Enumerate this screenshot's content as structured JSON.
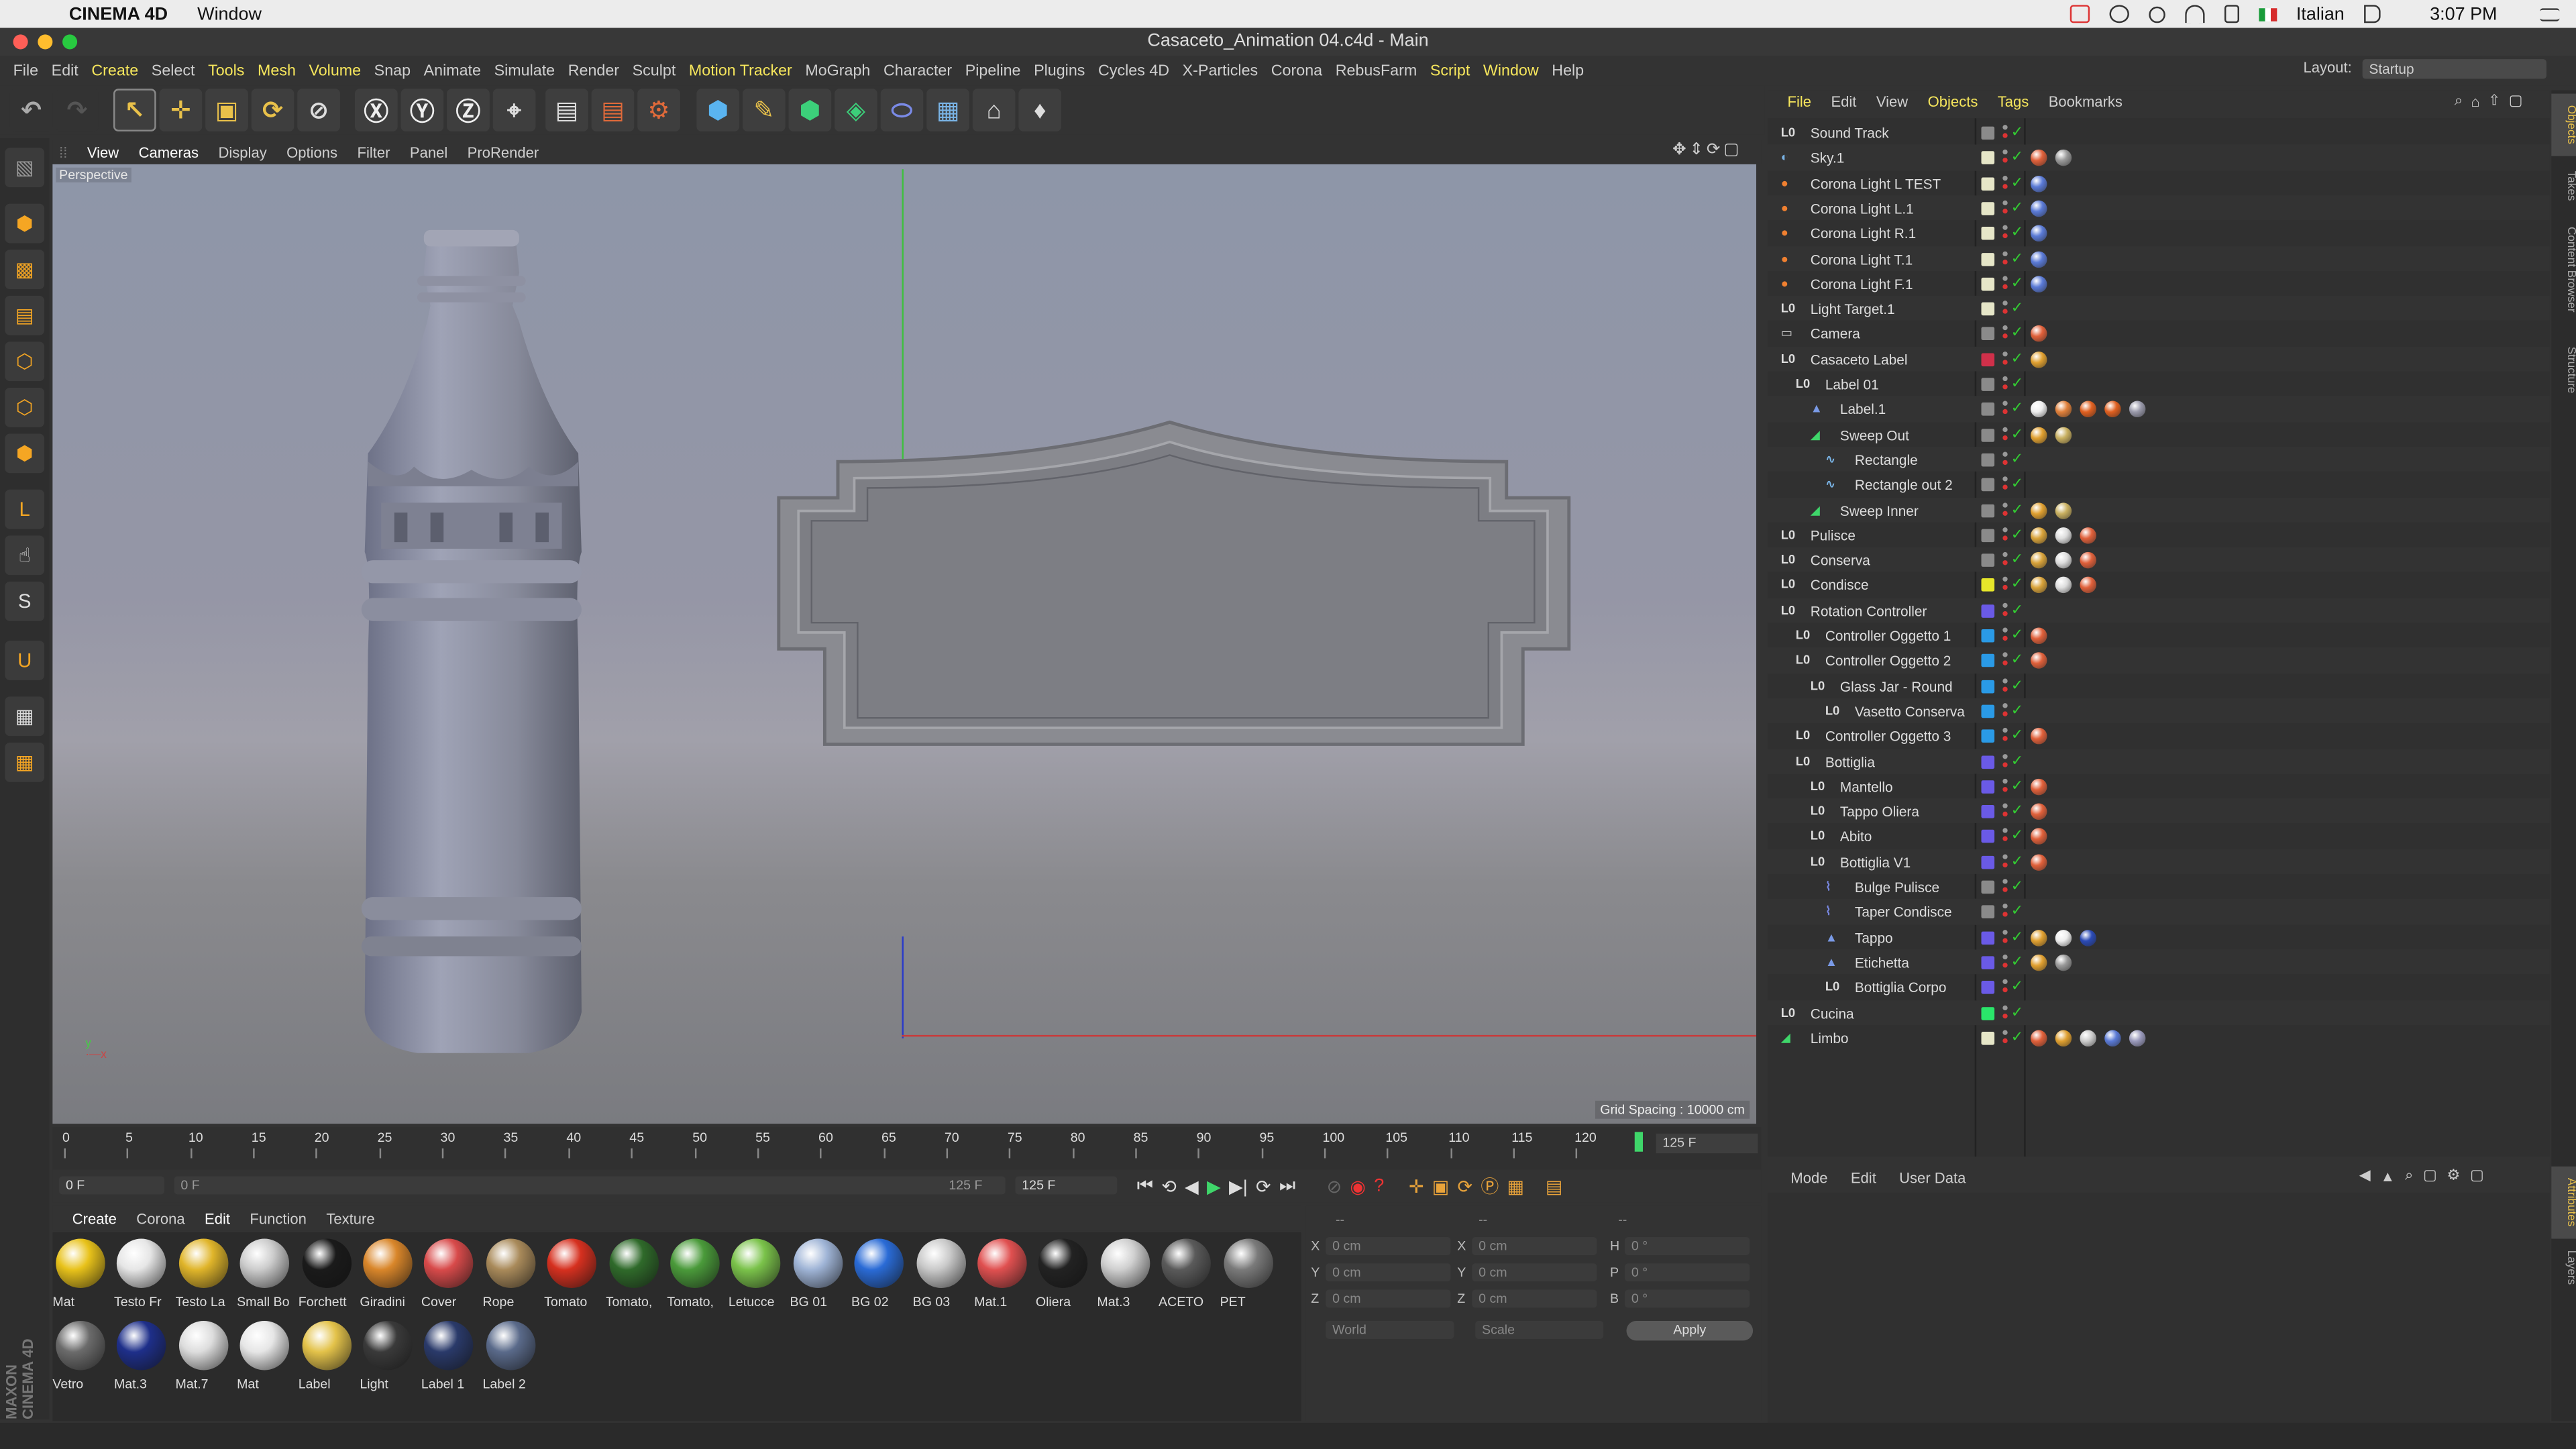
{
  "macbar": {
    "app_name": "CINEMA 4D",
    "window_menu": "Window",
    "keyboard": "Italian",
    "clock": "3:07 PM"
  },
  "window_title": "Casaceto_Animation 04.c4d - Main",
  "menu": [
    "File",
    "Edit",
    "Create",
    "Select",
    "Tools",
    "Mesh",
    "Volume",
    "Snap",
    "Animate",
    "Simulate",
    "Render",
    "Sculpt",
    "Motion Tracker",
    "MoGraph",
    "Character",
    "Pipeline",
    "Plugins",
    "Cycles 4D",
    "X-Particles",
    "Corona",
    "RebusFarm",
    "Script",
    "Window",
    "Help"
  ],
  "menu_highlight": [
    "Create",
    "Tools",
    "Mesh",
    "Volume",
    "Motion Tracker",
    "Script",
    "Window"
  ],
  "layout_label": "Layout:",
  "layout_value": "Startup",
  "viewport": {
    "menu": [
      "View",
      "Cameras",
      "Display",
      "Options",
      "Filter",
      "Panel",
      "ProRender"
    ],
    "camera_label": "Perspective",
    "grid_spacing": "Grid Spacing : 10000 cm"
  },
  "timeline": {
    "ticks": [
      "0",
      "5",
      "10",
      "15",
      "20",
      "25",
      "30",
      "35",
      "40",
      "45",
      "50",
      "55",
      "60",
      "65",
      "70",
      "75",
      "80",
      "85",
      "90",
      "95",
      "100",
      "105",
      "110",
      "115",
      "120"
    ],
    "end_frame": "125 F",
    "current": "0 F",
    "range_start": "0 F",
    "range_end": "125 F",
    "max": "125 F"
  },
  "material_manager": {
    "menu": [
      "Create",
      "Corona",
      "Edit",
      "Function",
      "Texture"
    ],
    "materials": [
      {
        "name": "Mat",
        "color": "#e8c21a"
      },
      {
        "name": "Testo Fr",
        "color": "#e6e6e6"
      },
      {
        "name": "Testo La",
        "color": "#e0b52a"
      },
      {
        "name": "Small Bo",
        "color": "#cccccc"
      },
      {
        "name": "Forchett",
        "color": "#1a1a1a"
      },
      {
        "name": "Giradini",
        "color": "#d9862a"
      },
      {
        "name": "Cover",
        "color": "#d84a4a"
      },
      {
        "name": "Rope",
        "color": "#a98a5a"
      },
      {
        "name": "Tomato",
        "color": "#d6301f"
      },
      {
        "name": "Tomato,",
        "color": "#2f6a2a"
      },
      {
        "name": "Tomato,",
        "color": "#4a9a3a"
      },
      {
        "name": "Letucce",
        "color": "#7ac24a"
      },
      {
        "name": "BG 01",
        "color": "#9fb4d6"
      },
      {
        "name": "BG 02",
        "color": "#2a6bd6"
      },
      {
        "name": "BG 03",
        "color": "#c9c9c9"
      },
      {
        "name": "Mat.1",
        "color": "#e05050"
      },
      {
        "name": "Oliera",
        "color": "#222222"
      },
      {
        "name": "Mat.3",
        "color": "#cfcfcf"
      },
      {
        "name": "ACETO",
        "color": "#5a5a5a"
      },
      {
        "name": "PET",
        "color": "#7a7a7a"
      },
      {
        "name": "Vetro",
        "color": "#6b6b6b"
      },
      {
        "name": "Mat.3",
        "color": "#1e2f8a"
      },
      {
        "name": "Mat.7",
        "color": "#dddddd"
      },
      {
        "name": "Mat",
        "color": "#e6e6e6"
      },
      {
        "name": "Label",
        "color": "#e3c24a"
      },
      {
        "name": "Light",
        "color": "#3a3a3a"
      },
      {
        "name": "Label 1",
        "color": "#2a3a6a"
      },
      {
        "name": "Label 2",
        "color": "#5a6a8a"
      }
    ]
  },
  "coordinates": {
    "headers": [
      "--",
      "--",
      "--"
    ],
    "rows": [
      {
        "a": "X",
        "av": "0 cm",
        "b": "X",
        "bv": "0 cm",
        "c": "H",
        "cv": "0 °"
      },
      {
        "a": "Y",
        "av": "0 cm",
        "b": "Y",
        "bv": "0 cm",
        "c": "P",
        "cv": "0 °"
      },
      {
        "a": "Z",
        "av": "0 cm",
        "b": "Z",
        "bv": "0 cm",
        "c": "B",
        "cv": "0 °"
      }
    ],
    "world": "World",
    "scale": "Scale",
    "apply": "Apply"
  },
  "object_manager": {
    "menu": [
      "File",
      "Edit",
      "View",
      "Objects",
      "Tags",
      "Bookmarks"
    ],
    "objects": [
      {
        "name": "Sound Track",
        "indent": 0,
        "color": "#8a8a8a",
        "icon": "null",
        "tags": []
      },
      {
        "name": "Sky.1",
        "indent": 0,
        "color": "#e6e6c8",
        "icon": "sky",
        "tags": [
          "#e0603a",
          "#999"
        ]
      },
      {
        "name": "Corona Light L TEST",
        "indent": 0,
        "color": "#e6e6c8",
        "icon": "light",
        "tags": [
          "#5a7ad6"
        ]
      },
      {
        "name": "Corona Light L.1",
        "indent": 0,
        "color": "#e6e6c8",
        "icon": "light",
        "tags": [
          "#5a7ad6"
        ]
      },
      {
        "name": "Corona Light R.1",
        "indent": 0,
        "color": "#e6e6c8",
        "icon": "light",
        "tags": [
          "#5a7ad6"
        ]
      },
      {
        "name": "Corona Light T.1",
        "indent": 0,
        "color": "#e6e6c8",
        "icon": "light",
        "tags": [
          "#5a7ad6"
        ]
      },
      {
        "name": "Corona Light F.1",
        "indent": 0,
        "color": "#e6e6c8",
        "icon": "light",
        "tags": [
          "#5a7ad6"
        ]
      },
      {
        "name": "Light Target.1",
        "indent": 0,
        "color": "#e6e6c8",
        "icon": "null",
        "tags": []
      },
      {
        "name": "Camera",
        "indent": 0,
        "color": "#8a8a8a",
        "icon": "camera",
        "tags": [
          "#e0603a"
        ]
      },
      {
        "name": "Casaceto Label",
        "indent": 0,
        "color": "#d0304a",
        "icon": "null",
        "tags": [
          "#e0a030"
        ]
      },
      {
        "name": "Label 01",
        "indent": 1,
        "color": "#8a8a8a",
        "icon": "null",
        "tags": []
      },
      {
        "name": "Label.1",
        "indent": 2,
        "color": "#8a8a8a",
        "icon": "poly",
        "tags": [
          "#eee",
          "#e0803a",
          "#e06020",
          "#e06020",
          "#99a"
        ]
      },
      {
        "name": "Sweep Out",
        "indent": 2,
        "color": "#8a8a8a",
        "icon": "sweep",
        "tags": [
          "#e0a030",
          "#c9b060"
        ]
      },
      {
        "name": "Rectangle",
        "indent": 3,
        "color": "#8a8a8a",
        "icon": "spline",
        "tags": []
      },
      {
        "name": "Rectangle out 2",
        "indent": 3,
        "color": "#8a8a8a",
        "icon": "spline",
        "tags": []
      },
      {
        "name": "Sweep Inner",
        "indent": 2,
        "color": "#8a8a8a",
        "icon": "sweep",
        "tags": [
          "#e0a030",
          "#c9b060"
        ]
      },
      {
        "name": "Pulisce",
        "indent": 0,
        "color": "#8a8a8a",
        "icon": "null",
        "tags": [
          "#d9a33a",
          "#ddd",
          "#e0603a"
        ]
      },
      {
        "name": "Conserva",
        "indent": 0,
        "color": "#8a8a8a",
        "icon": "null",
        "tags": [
          "#d9a33a",
          "#ddd",
          "#e0603a"
        ]
      },
      {
        "name": "Condisce",
        "indent": 0,
        "color": "#e6e62a",
        "icon": "null",
        "tags": [
          "#d9a33a",
          "#ddd",
          "#e0603a"
        ]
      },
      {
        "name": "Rotation Controller",
        "indent": 0,
        "color": "#6a5ae6",
        "icon": "null",
        "tags": []
      },
      {
        "name": "Controller Oggetto 1",
        "indent": 1,
        "color": "#2a9ae6",
        "icon": "null",
        "tags": [
          "#e0603a"
        ]
      },
      {
        "name": "Controller Oggetto 2",
        "indent": 1,
        "color": "#2a9ae6",
        "icon": "null",
        "tags": [
          "#e0603a"
        ]
      },
      {
        "name": "Glass Jar - Round",
        "indent": 2,
        "color": "#2a9ae6",
        "icon": "null",
        "tags": []
      },
      {
        "name": "Vasetto Conserva",
        "indent": 3,
        "color": "#2a9ae6",
        "icon": "null",
        "tags": []
      },
      {
        "name": "Controller Oggetto 3",
        "indent": 1,
        "color": "#2a9ae6",
        "icon": "null",
        "tags": [
          "#e0603a"
        ]
      },
      {
        "name": "Bottiglia",
        "indent": 1,
        "color": "#6a5ae6",
        "icon": "null",
        "tags": []
      },
      {
        "name": "Mantello",
        "indent": 2,
        "color": "#6a5ae6",
        "icon": "null",
        "tags": [
          "#e0603a"
        ]
      },
      {
        "name": "Tappo Oliera",
        "indent": 2,
        "color": "#6a5ae6",
        "icon": "null",
        "tags": [
          "#e0603a"
        ]
      },
      {
        "name": "Abito",
        "indent": 2,
        "color": "#6a5ae6",
        "icon": "null",
        "tags": [
          "#e0603a"
        ]
      },
      {
        "name": "Bottiglia V1",
        "indent": 2,
        "color": "#6a5ae6",
        "icon": "null",
        "tags": [
          "#e0603a"
        ]
      },
      {
        "name": "Bulge Pulisce",
        "indent": 3,
        "color": "#8a8a8a",
        "icon": "deformer",
        "tags": []
      },
      {
        "name": "Taper Condisce",
        "indent": 3,
        "color": "#8a8a8a",
        "icon": "deformer",
        "tags": []
      },
      {
        "name": "Tappo",
        "indent": 3,
        "color": "#6a5ae6",
        "icon": "poly",
        "tags": [
          "#e0a030",
          "#eee",
          "#2a4ab6"
        ]
      },
      {
        "name": "Etichetta",
        "indent": 3,
        "color": "#6a5ae6",
        "icon": "poly",
        "tags": [
          "#e0a030",
          "#999"
        ]
      },
      {
        "name": "Bottiglia Corpo",
        "indent": 3,
        "color": "#6a5ae6",
        "icon": "null",
        "tags": []
      },
      {
        "name": "Cucina",
        "indent": 0,
        "color": "#2ae66a",
        "icon": "null",
        "tags": []
      },
      {
        "name": "Limbo",
        "indent": 0,
        "color": "#e6e6c8",
        "icon": "sweep",
        "tags": [
          "#e0603a",
          "#e0a030",
          "#ccc",
          "#5a7ad6",
          "#99b"
        ]
      }
    ]
  },
  "attributes": {
    "menu": [
      "Mode",
      "Edit",
      "User Data"
    ]
  },
  "side_tabs_top": [
    "Objects",
    "Takes",
    "Content Browser",
    "Structure"
  ],
  "side_tabs_bottom": [
    "Attributes",
    "Layers"
  ],
  "maxon_label": "MAXON CINEMA 4D"
}
